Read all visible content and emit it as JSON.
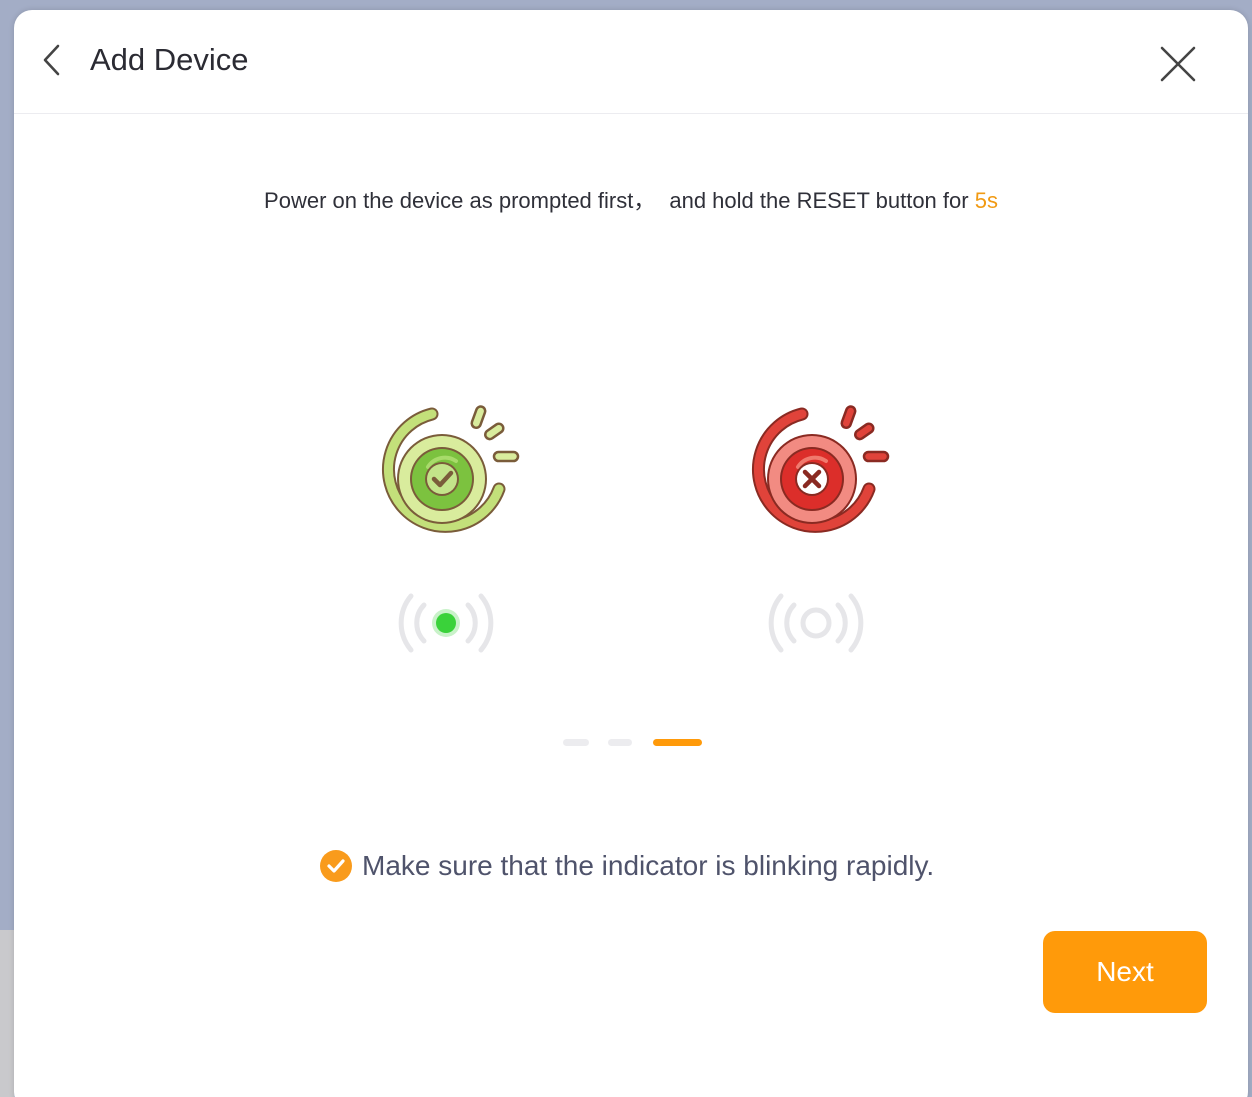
{
  "header": {
    "title": "Add Device",
    "back_icon": "chevron-left-icon",
    "close_icon": "close-icon"
  },
  "instruction": {
    "text": "Power on the device as prompted first，",
    "text2": "and hold the RESET button for",
    "highlight": "5s",
    "highlight_color": "#f19a13"
  },
  "illustrations": [
    {
      "name": "success-power-icon",
      "color": "#8cc63f"
    },
    {
      "name": "error-power-icon",
      "color": "#e53935"
    }
  ],
  "indicators": [
    {
      "name": "signal-blinking-icon",
      "state": "blinking",
      "led_color": "#3ad23a"
    },
    {
      "name": "signal-off-icon",
      "state": "off"
    }
  ],
  "pager": {
    "total": 3,
    "active_index": 2,
    "active_color": "#ff9a0a"
  },
  "confirmation": {
    "text": "Make sure that the indicator is blinking rapidly.",
    "checked": true,
    "check_color": "#f99b1c"
  },
  "next_button": {
    "label": "Next",
    "color": "#ff9a0a"
  }
}
